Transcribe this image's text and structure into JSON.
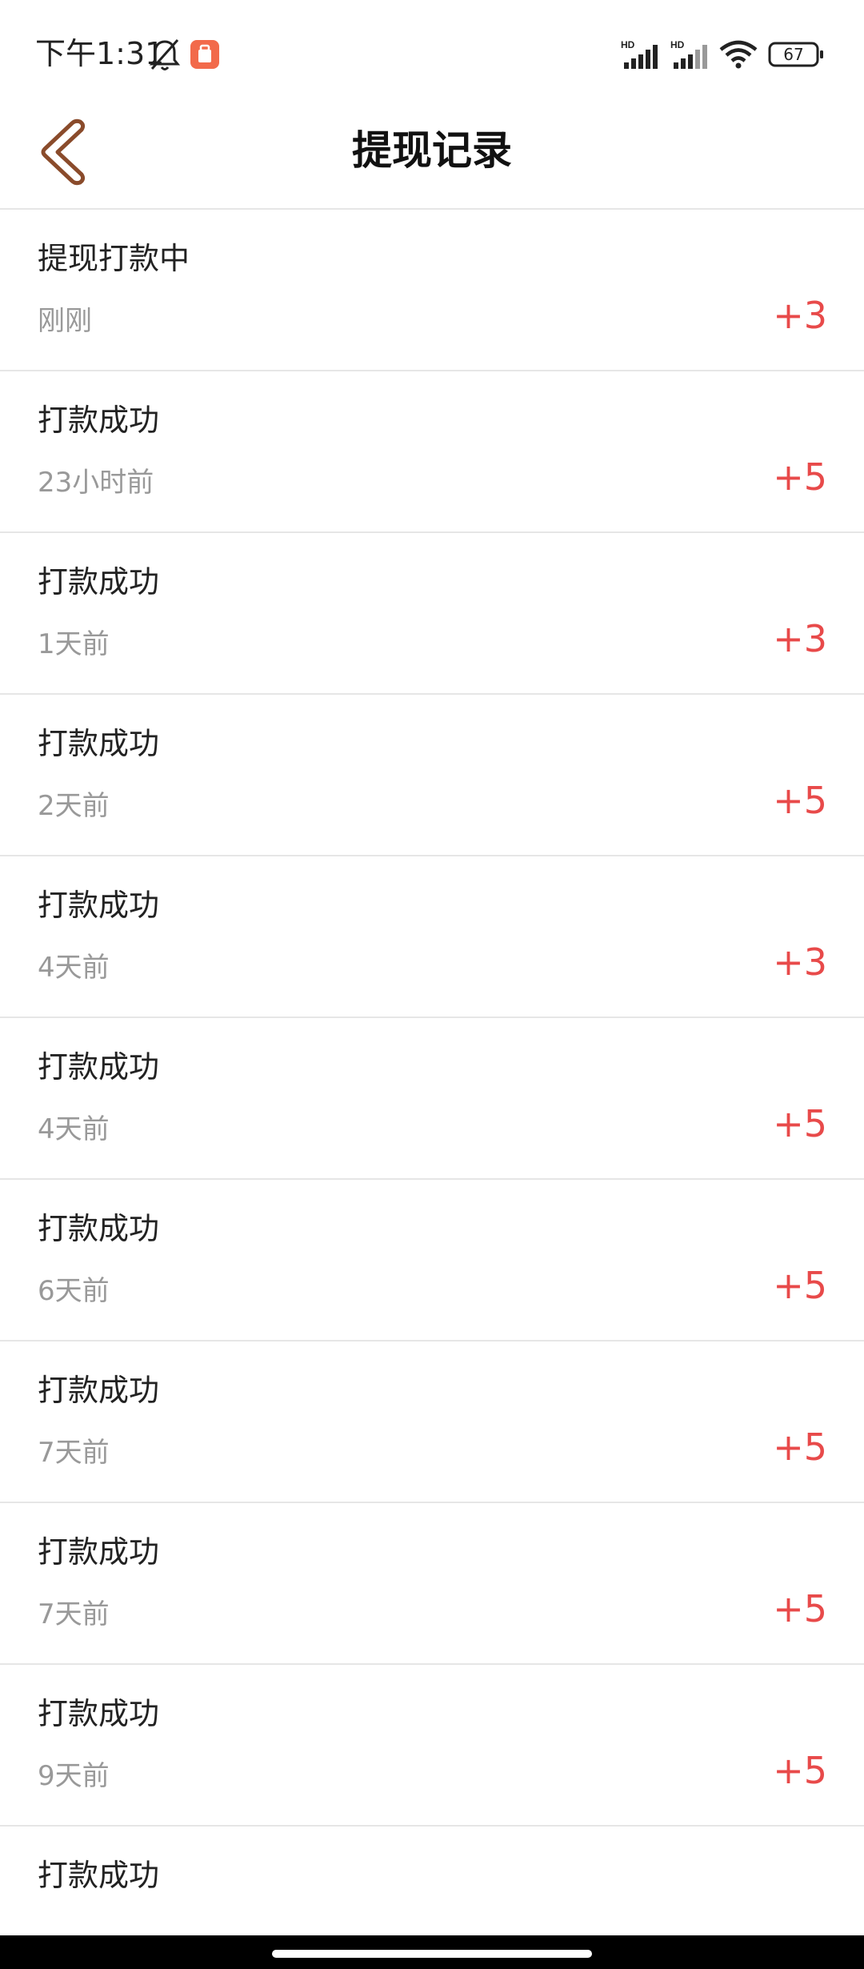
{
  "status_bar": {
    "time": "下午1:31",
    "battery": "67",
    "icons": [
      "bell-off-icon",
      "app-notification-icon",
      "hd-signal-icon",
      "hd-signal-icon",
      "wifi-icon",
      "battery-icon"
    ]
  },
  "nav": {
    "title": "提现记录",
    "back_icon": "chevron-left-icon"
  },
  "colors": {
    "amount": "#e84a4a",
    "secondary_text": "#999999",
    "divider": "#e6e6e6",
    "back_icon_stroke": "#8a4b2b"
  },
  "records": [
    {
      "status": "提现打款中",
      "time": "刚刚",
      "amount": "+3"
    },
    {
      "status": "打款成功",
      "time": "23小时前",
      "amount": "+5"
    },
    {
      "status": "打款成功",
      "time": "1天前",
      "amount": "+3"
    },
    {
      "status": "打款成功",
      "time": "2天前",
      "amount": "+5"
    },
    {
      "status": "打款成功",
      "time": "4天前",
      "amount": "+3"
    },
    {
      "status": "打款成功",
      "time": "4天前",
      "amount": "+5"
    },
    {
      "status": "打款成功",
      "time": "6天前",
      "amount": "+5"
    },
    {
      "status": "打款成功",
      "time": "7天前",
      "amount": "+5"
    },
    {
      "status": "打款成功",
      "time": "7天前",
      "amount": "+5"
    },
    {
      "status": "打款成功",
      "time": "9天前",
      "amount": "+5"
    },
    {
      "status": "打款成功"
    }
  ]
}
